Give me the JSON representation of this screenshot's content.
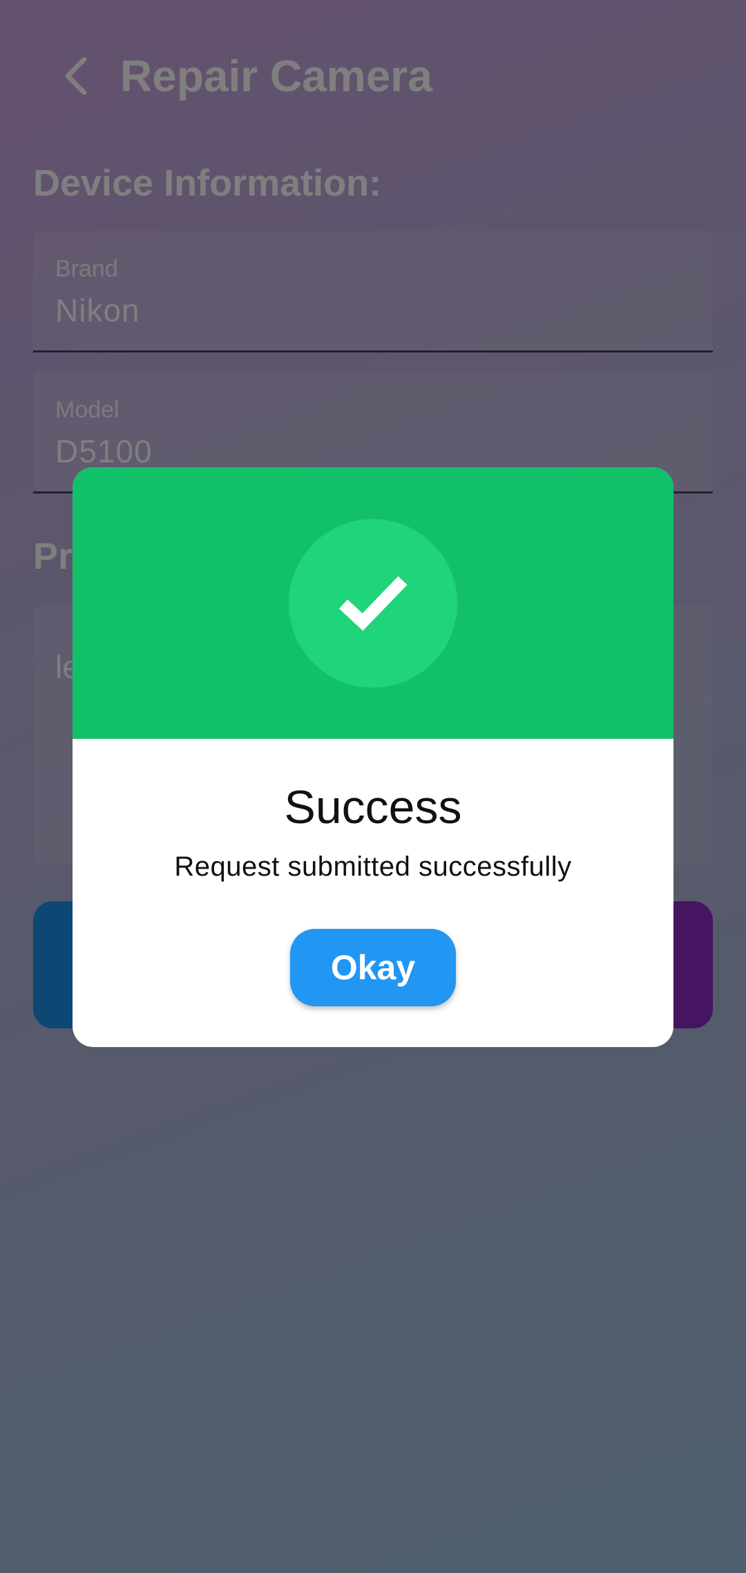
{
  "header": {
    "title": "Repair Camera",
    "back_icon": "chevron-left-icon"
  },
  "device_section": {
    "title": "Device Information:",
    "brand": {
      "label": "Brand",
      "value": "Nikon"
    },
    "model": {
      "label": "Model",
      "value": "D5100"
    }
  },
  "problem_section": {
    "title_visible": "Pr",
    "text_visible": "le"
  },
  "dialog": {
    "icon": "check-icon",
    "title": "Success",
    "message": "Request submitted successfully",
    "button_label": "Okay",
    "colors": {
      "header": "#13c06a",
      "icon_circle": "#1fd47b",
      "button": "#2196f3"
    }
  },
  "colors": {
    "primary_button": "#1f8fe8",
    "secondary_button": "#8b2bc4"
  }
}
